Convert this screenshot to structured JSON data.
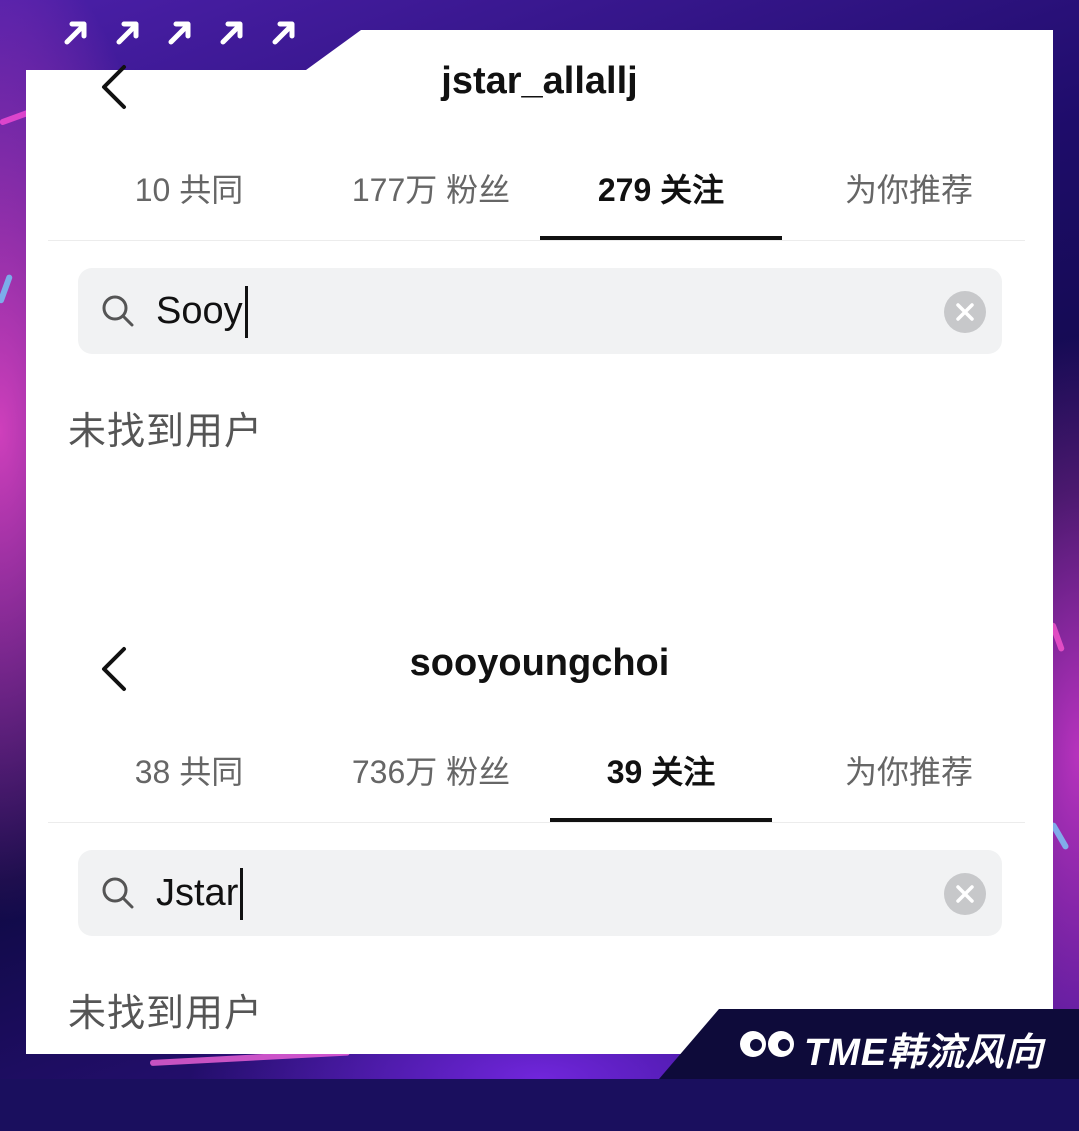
{
  "screens": [
    {
      "title": "jstar_allallj",
      "tabs": [
        {
          "label": "10 共同",
          "active": false
        },
        {
          "label": "177万 粉丝",
          "active": false
        },
        {
          "label": "279 关注",
          "active": true
        },
        {
          "label": "为你推荐",
          "active": false
        }
      ],
      "search_value": "Sooy",
      "empty_text": "未找到用户"
    },
    {
      "title": "sooyoungchoi",
      "tabs": [
        {
          "label": "38 共同",
          "active": false
        },
        {
          "label": "736万 粉丝",
          "active": false
        },
        {
          "label": "39 关注",
          "active": true
        },
        {
          "label": "为你推荐",
          "active": false
        }
      ],
      "search_value": "Jstar",
      "empty_text": "未找到用户"
    }
  ],
  "icons": {
    "back": "chevron-left-icon",
    "search": "search-icon",
    "clear": "clear-icon",
    "decor": "arrow-up-right-icon",
    "logo": "eyes-logo-icon"
  },
  "watermark": {
    "text": "TME韩流风向标"
  },
  "colors": {
    "accent": "#111111",
    "search_bg": "#f1f2f3",
    "tab_inactive": "#666666"
  }
}
